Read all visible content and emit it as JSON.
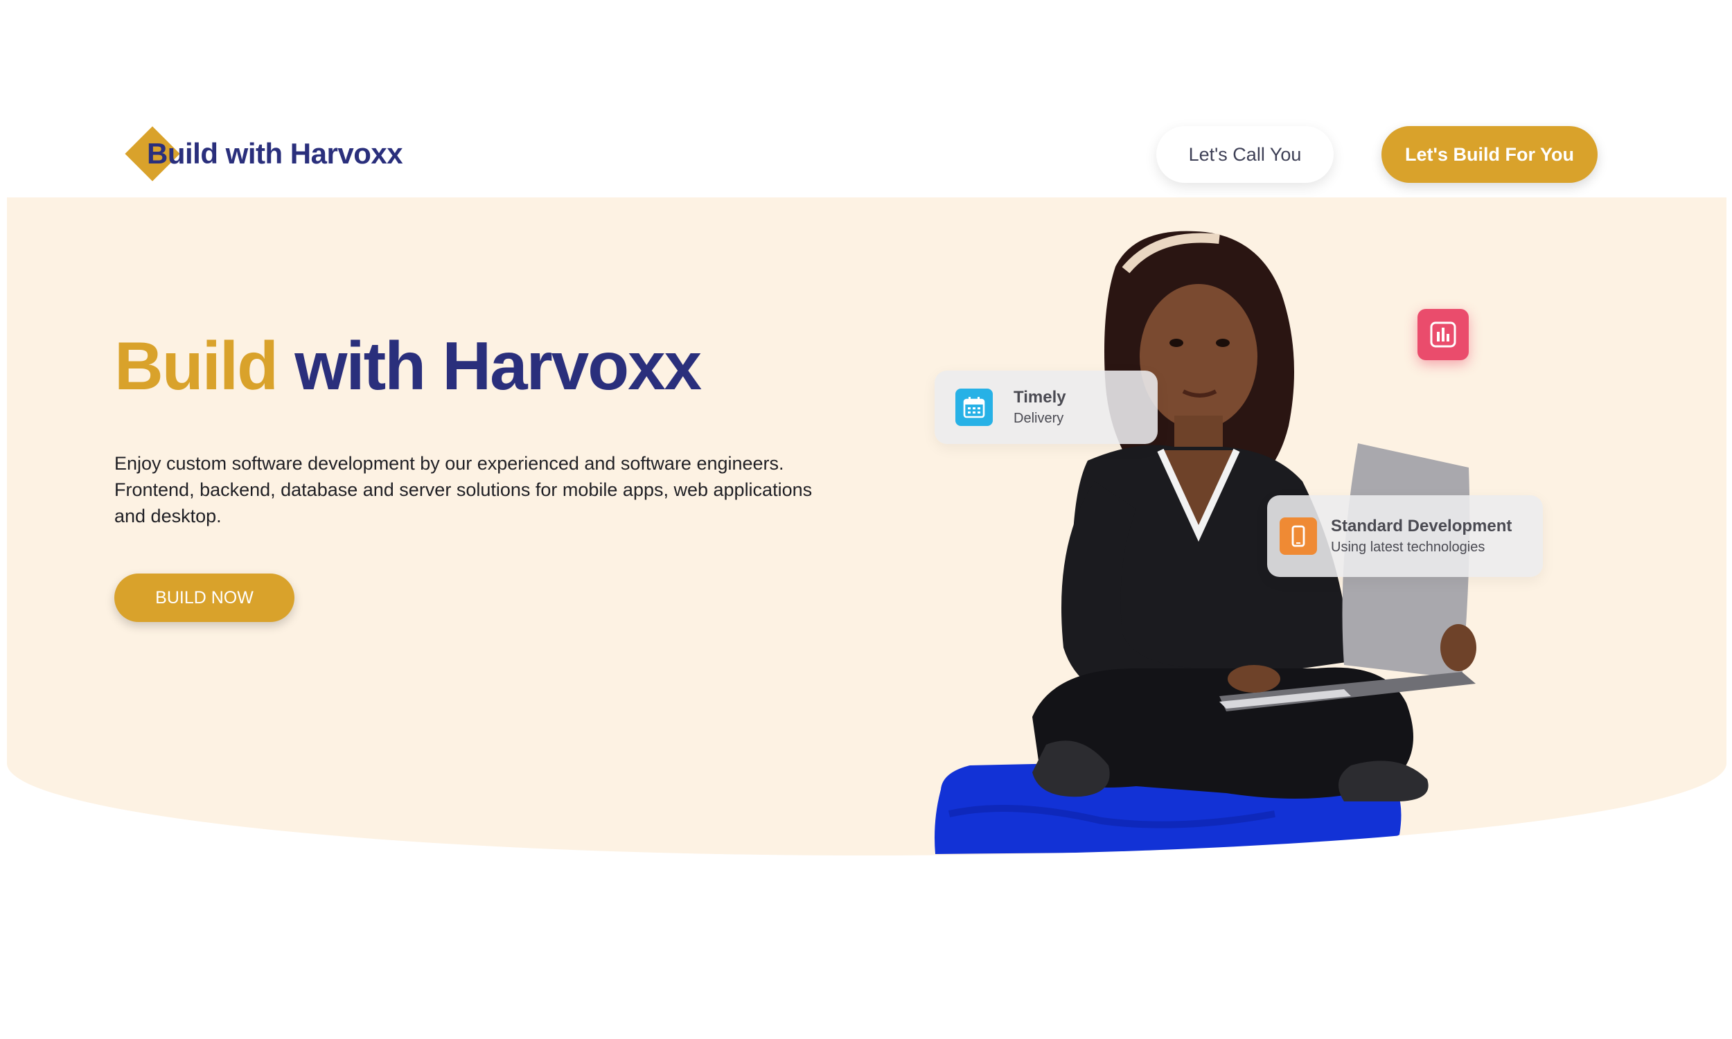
{
  "header": {
    "logo_text": "Build with Harvoxx",
    "call_button_label": "Let's Call You",
    "build_button_label": "Let's Build For You"
  },
  "hero": {
    "title_highlight": "Build",
    "title_rest": "with Harvoxx",
    "description": "Enjoy custom software development by our experienced and software engineers. Frontend, backend, database and server solutions for mobile apps, web applications and desktop.",
    "cta_label": "BUILD NOW"
  },
  "cards": {
    "timely": {
      "title": "Timely",
      "subtitle": "Delivery",
      "icon": "calendar-icon"
    },
    "standard": {
      "title": "Standard Development",
      "subtitle": "Using latest technologies",
      "icon": "mobile-phone-icon"
    },
    "badge_icon": "bar-chart-icon"
  },
  "illustration": {
    "subject": "woman-with-laptop-photo"
  },
  "colors": {
    "brand_gold": "#d9a22b",
    "brand_navy": "#2a2f7c",
    "hero_background": "#fdf2e3",
    "timely_icon_bg": "#27b1e6",
    "standard_icon_bg": "#ef8a34",
    "badge_bg": "#ea4c6c"
  }
}
